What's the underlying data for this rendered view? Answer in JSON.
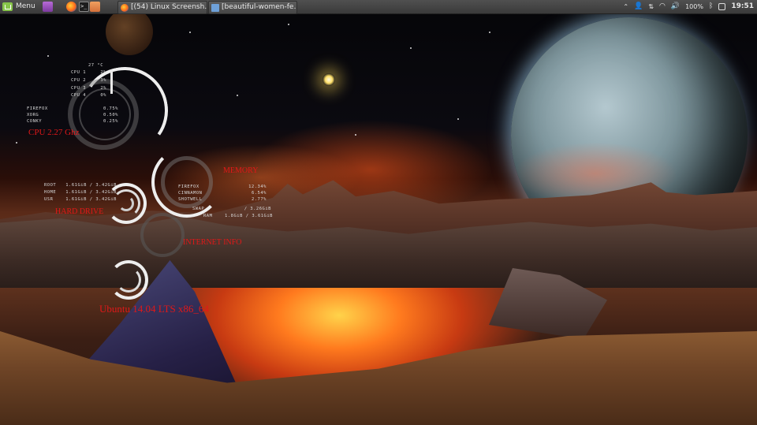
{
  "panel": {
    "menu_label": "Menu",
    "launchers": [
      "files-launcher",
      "firefox-launcher",
      "terminal-launcher",
      "folder-launcher"
    ],
    "tasks": [
      {
        "label": "[(54) Linux Screensh…"
      },
      {
        "label": "[beautiful-women-fe…"
      }
    ],
    "tray": {
      "battery": "100%",
      "clock": "19:51"
    }
  },
  "conky": {
    "temp": "27 °C",
    "cpus": [
      {
        "label": "CPU 1",
        "value": "2%"
      },
      {
        "label": "CPU 2",
        "value": "3%"
      },
      {
        "label": "CPU 3",
        "value": "2%"
      },
      {
        "label": "CPU 4",
        "value": "0%"
      }
    ],
    "top_cpu": [
      {
        "name": "FIREFOX",
        "value": "0.75%"
      },
      {
        "name": "XORG",
        "value": "0.50%"
      },
      {
        "name": "CONKY",
        "value": "0.25%"
      }
    ],
    "cpu_label": "CPU 2.27 Ghz",
    "memory_label": "MEMORY",
    "top_mem": [
      {
        "name": "FIREFOX",
        "value": "12.34%"
      },
      {
        "name": "CINNAMON",
        "value": "6.54%"
      },
      {
        "name": "SHOTWELL",
        "value": "2.77%"
      }
    ],
    "swap": {
      "label": "SWAP",
      "value": "/ 3.26GiB"
    },
    "ram": {
      "label": "RAM",
      "value": "1.8GiB / 3.61GiB"
    },
    "disks": [
      {
        "name": "ROOT",
        "value": "1.61GiB / 3.42GiB"
      },
      {
        "name": "HOME",
        "value": "1.61GiB / 3.42GiB"
      },
      {
        "name": "USR",
        "value": "1.61GiB / 3.42GiB"
      }
    ],
    "hdd_label": "HARD DRIVE",
    "net_label": "INTERNET INFO",
    "os_label": "Ubuntu 14.04 LTS x86_64"
  }
}
